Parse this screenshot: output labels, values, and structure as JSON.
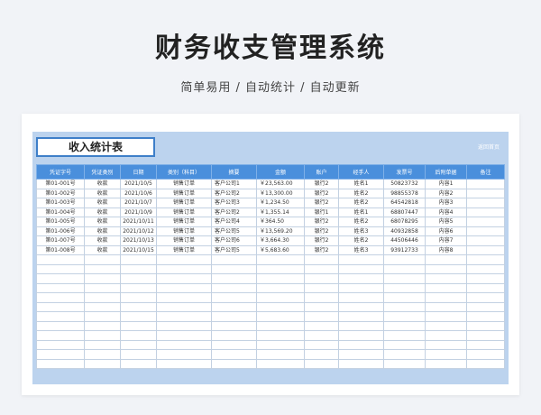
{
  "header": {
    "title": "财务收支管理系统",
    "subtitle": "简单易用 / 自动统计 / 自动更新"
  },
  "sheet": {
    "title": "收入统计表",
    "back_label": "返回首页",
    "columns": [
      "凭证字号",
      "凭证类别",
      "日期",
      "类别（科目）",
      "摘要",
      "金额",
      "账户",
      "经手人",
      "发票号",
      "后附单据",
      "备注"
    ],
    "rows": [
      [
        "第01-001号",
        "收款",
        "2021/10/5",
        "销售订单",
        "客户公司1",
        "￥23,563.00",
        "银行2",
        "姓名1",
        "50823732",
        "内容1",
        ""
      ],
      [
        "第01-002号",
        "收款",
        "2021/10/6",
        "销售订单",
        "客户公司2",
        "￥13,300.00",
        "银行2",
        "姓名2",
        "98855378",
        "内容2",
        ""
      ],
      [
        "第01-003号",
        "收款",
        "2021/10/7",
        "销售订单",
        "客户公司3",
        "￥1,234.50",
        "银行2",
        "姓名2",
        "64542818",
        "内容3",
        ""
      ],
      [
        "第01-004号",
        "收款",
        "2021/10/9",
        "销售订单",
        "客户公司2",
        "￥1,355.14",
        "银行1",
        "姓名1",
        "68807447",
        "内容4",
        ""
      ],
      [
        "第01-005号",
        "收款",
        "2021/10/11",
        "销售订单",
        "客户公司4",
        "￥364.50",
        "银行2",
        "姓名2",
        "68078295",
        "内容5",
        ""
      ],
      [
        "第01-006号",
        "收款",
        "2021/10/12",
        "销售订单",
        "客户公司5",
        "￥13,569.20",
        "银行2",
        "姓名3",
        "40932858",
        "内容6",
        ""
      ],
      [
        "第01-007号",
        "收款",
        "2021/10/13",
        "销售订单",
        "客户公司6",
        "￥3,664.30",
        "银行2",
        "姓名2",
        "44506446",
        "内容7",
        ""
      ],
      [
        "第01-008号",
        "收款",
        "2021/10/15",
        "销售订单",
        "客户公司5",
        "￥5,683.60",
        "银行2",
        "姓名3",
        "93912733",
        "内容8",
        ""
      ]
    ],
    "empty_rows": 12
  }
}
